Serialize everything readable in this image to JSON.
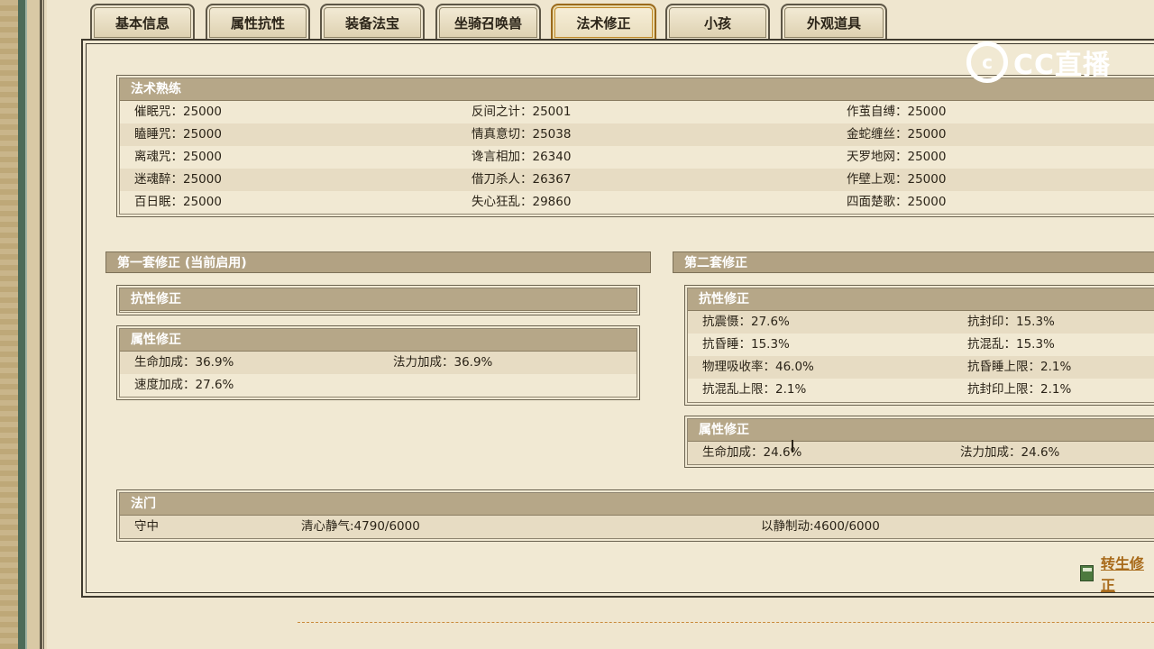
{
  "tabs": [
    {
      "label": "基本信息"
    },
    {
      "label": "属性抗性"
    },
    {
      "label": "装备法宝"
    },
    {
      "label": "坐骑召唤兽"
    },
    {
      "label": "法术修正",
      "active": true
    },
    {
      "label": "小孩"
    },
    {
      "label": "外观道具"
    }
  ],
  "watermark": {
    "text": "CC直播",
    "icon": "cc-logo-icon"
  },
  "proficiency": {
    "title": "法术熟练",
    "rows": [
      [
        "催眠咒：25000",
        "反间之计：25001",
        "作茧自缚：25000"
      ],
      [
        "瞌睡咒：25000",
        "情真意切：25038",
        "金蛇缠丝：25000"
      ],
      [
        "离魂咒：25000",
        "谗言相加：26340",
        "天罗地网：25000"
      ],
      [
        "迷魂醉：25000",
        "借刀杀人：26367",
        "作壁上观：25000"
      ],
      [
        "百日眠：25000",
        "失心狂乱：29860",
        "四面楚歌：25000"
      ]
    ]
  },
  "set1": {
    "title": "第一套修正 (当前启用)",
    "resist_title": "抗性修正",
    "attr_title": "属性修正",
    "attr_rows": [
      [
        "生命加成：36.9%",
        "法力加成：36.9%"
      ],
      [
        "速度加成：27.6%",
        ""
      ]
    ]
  },
  "set2": {
    "title": "第二套修正",
    "resist_title": "抗性修正",
    "resist_rows": [
      [
        "抗震慑：27.6%",
        "抗封印：15.3%"
      ],
      [
        "抗昏睡：15.3%",
        "抗混乱：15.3%"
      ],
      [
        "物理吸收率：46.0%",
        "抗昏睡上限：2.1%"
      ],
      [
        "抗混乱上限：2.1%",
        "抗封印上限：2.1%"
      ]
    ],
    "attr_title": "属性修正",
    "attr_rows": [
      [
        "生命加成：24.6%",
        "法力加成：24.6%"
      ]
    ]
  },
  "famen": {
    "title": "法门",
    "values": [
      "守中",
      "清心静气:4790/6000",
      "以静制动:4600/6000"
    ]
  },
  "footer": {
    "link_text": "转生修正",
    "icon": "calculator-icon"
  }
}
